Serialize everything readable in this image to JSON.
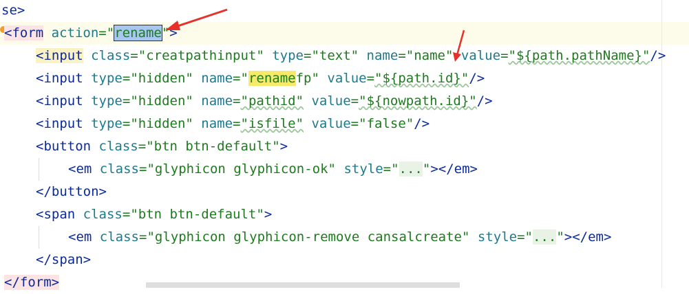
{
  "editor": {
    "lines": [
      {
        "close_tag": "se>"
      },
      {
        "open": "<form",
        "attr": "action",
        "eq": "=\"",
        "value": "rename",
        "end": "\">"
      },
      {
        "tag": "<input",
        "a1": "class",
        "v1": "\"creatpathinput\"",
        "a2": "type",
        "v2": "\"text\"",
        "a3": "name",
        "v3": "\"name\"",
        "a4": "value",
        "v4": "\"${path.pathName}\"",
        "end": "/>"
      },
      {
        "tag": "<input",
        "a1": "type",
        "v1": "\"hidden\"",
        "a2": "name",
        "v2_q": "\"",
        "v2_match": "rename",
        "v2_rest": "fp\"",
        "a3": "value",
        "v3": "\"${path.id}\"",
        "end": "/>"
      },
      {
        "tag": "<input",
        "a1": "type",
        "v1": "\"hidden\"",
        "a2": "name",
        "v2": "\"pathid\"",
        "a3": "value",
        "v3": "\"${nowpath.id}\"",
        "end": "/>"
      },
      {
        "tag": "<input",
        "a1": "type",
        "v1": "\"hidden\"",
        "a2": "name",
        "v2": "\"isfile\"",
        "a3": "value",
        "v3": "\"false\"",
        "end": "/>"
      },
      {
        "tag": "<button",
        "a1": "class",
        "v1": "\"btn btn-default\"",
        "end": ">"
      },
      {
        "tag": "<em",
        "a1": "class",
        "v1": "\"glyphicon glyphicon-ok\"",
        "a2": "style",
        "v2_q": "=\"",
        "fold": "...",
        "v2_end": "\"",
        "end": "></em>"
      },
      {
        "close_tag": "</button>"
      },
      {
        "tag": "<span",
        "a1": "class",
        "v1": "\"btn btn-default\"",
        "end": ">"
      },
      {
        "tag": "<em",
        "a1": "class",
        "v1": "\"glyphicon glyphicon-remove cansalcreate\"",
        "a2": "style",
        "v2_q": "=\"",
        "fold": "...",
        "v2_end": "\"",
        "end": "></em>"
      },
      {
        "close_tag": "</span>"
      },
      {
        "close_tag": "</form>"
      }
    ]
  },
  "colors": {
    "tag": "#0a2a9c",
    "attr": "#1c7a8c",
    "string": "#1e7a1e",
    "selection": "#a7c7f0",
    "match": "#f7ea6a",
    "arrow": "#e8302a"
  }
}
